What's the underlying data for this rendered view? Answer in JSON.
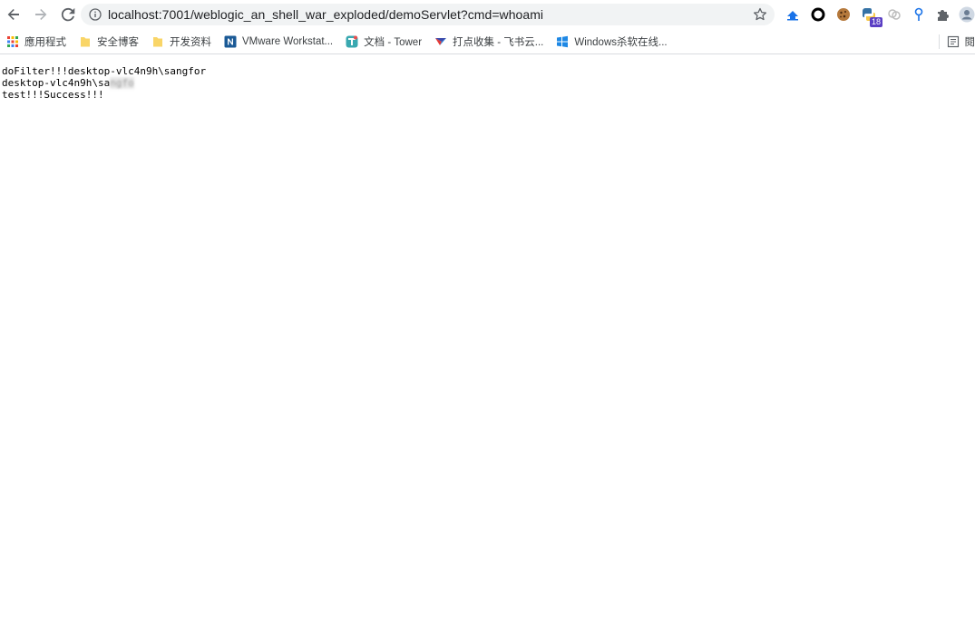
{
  "browser": {
    "url": "localhost:7001/weblogic_an_shell_war_exploded/demoServlet?cmd=whoami",
    "extension_badge": "18"
  },
  "bookmarks": {
    "items": [
      {
        "label": "應用程式",
        "icon": "apps-grid-icon"
      },
      {
        "label": "安全博客",
        "icon": "folder-icon"
      },
      {
        "label": "开发资料",
        "icon": "folder-icon"
      },
      {
        "label": "VMware Workstat...",
        "icon": "n-logo-icon"
      },
      {
        "label": "文档 - Tower",
        "icon": "tower-icon"
      },
      {
        "label": "打点收集 - 飞书云...",
        "icon": "feishu-icon"
      },
      {
        "label": "Windows杀软在线...",
        "icon": "windows-icon"
      }
    ],
    "reading_list_label": "閱"
  },
  "page": {
    "lines": [
      "doFilter!!!desktop-vlc4n9h\\sangfor",
      "desktop-vlc4n9h\\sa",
      "test!!!Success!!!"
    ],
    "obscured_fragment": "ngfo"
  },
  "colors": {
    "accent": "#1a73e8",
    "folder": "#f9d567",
    "omnibox": "#f1f3f4"
  }
}
